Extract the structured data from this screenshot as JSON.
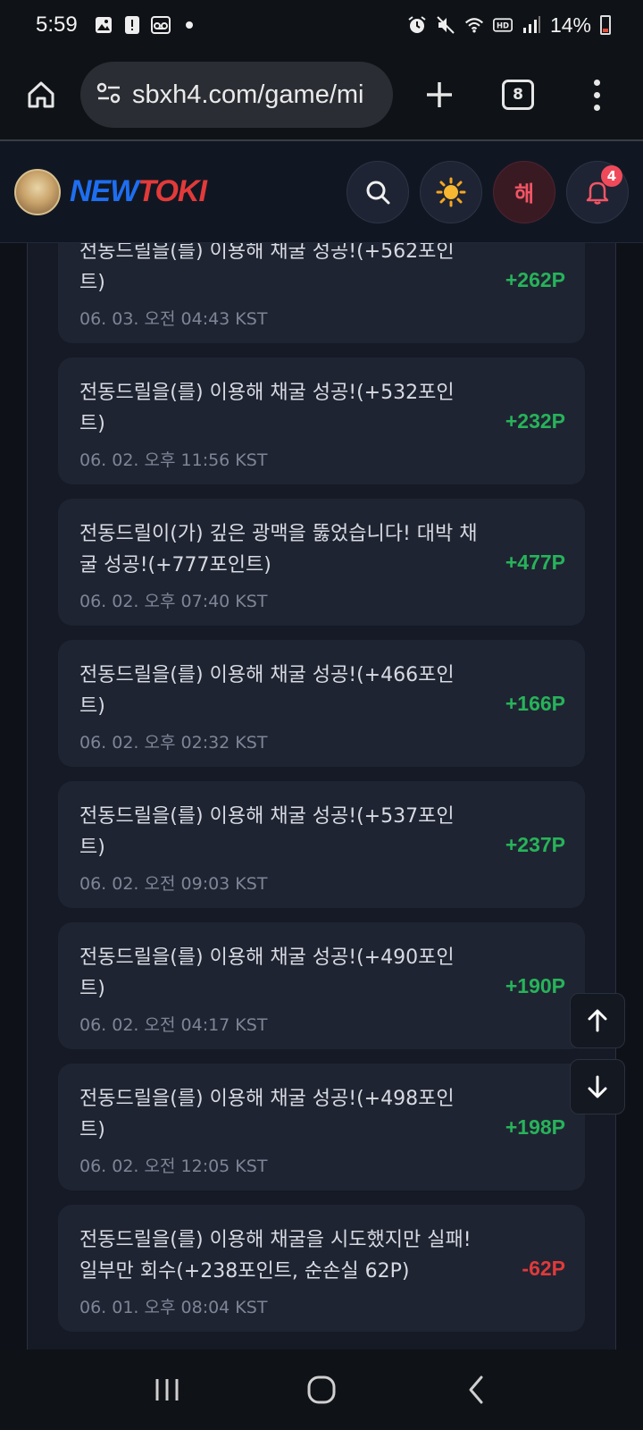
{
  "status_bar": {
    "time": "5:59",
    "battery_percent": "14%",
    "icons": [
      "image-icon",
      "alert-icon",
      "voicemail-icon",
      "dot-icon",
      "alarm-icon",
      "mute-icon",
      "wifi-icon",
      "hd-icon",
      "signal-icon",
      "battery-icon"
    ]
  },
  "browser": {
    "url": "sbxh4.com/game/mi",
    "tab_count": "8"
  },
  "site_header": {
    "logo_new": "NEW",
    "logo_toki": "TOKI",
    "hae_label": "해",
    "notification_count": "4"
  },
  "items": [
    {
      "message": "전동드릴을(를) 이용해 채굴 성공!(+562포인트)",
      "date": "06. 03. 오전 04:43 KST",
      "points": "+262P",
      "type": "gain"
    },
    {
      "message": "전동드릴을(를) 이용해 채굴 성공!(+532포인트)",
      "date": "06. 02. 오후 11:56 KST",
      "points": "+232P",
      "type": "gain"
    },
    {
      "message": "전동드릴이(가) 깊은 광맥을 뚫었습니다! 대박 채굴 성공!(+777포인트)",
      "date": "06. 02. 오후 07:40 KST",
      "points": "+477P",
      "type": "gain"
    },
    {
      "message": "전동드릴을(를) 이용해 채굴 성공!(+466포인트)",
      "date": "06. 02. 오후 02:32 KST",
      "points": "+166P",
      "type": "gain"
    },
    {
      "message": "전동드릴을(를) 이용해 채굴 성공!(+537포인트)",
      "date": "06. 02. 오전 09:03 KST",
      "points": "+237P",
      "type": "gain"
    },
    {
      "message": "전동드릴을(를) 이용해 채굴 성공!(+490포인트)",
      "date": "06. 02. 오전 04:17 KST",
      "points": "+190P",
      "type": "gain"
    },
    {
      "message": "전동드릴을(를) 이용해 채굴 성공!(+498포인트)",
      "date": "06. 02. 오전 12:05 KST",
      "points": "+198P",
      "type": "gain"
    },
    {
      "message": "전동드릴을(를) 이용해 채굴을 시도했지만 실패! 일부만 회수(+238포인트, 순손실 62P)",
      "date": "06. 01. 오후 08:04 KST",
      "points": "-62P",
      "type": "loss"
    }
  ],
  "colors": {
    "gain": "#27b35a",
    "loss": "#e03a3a",
    "card_bg": "#1f2432"
  }
}
